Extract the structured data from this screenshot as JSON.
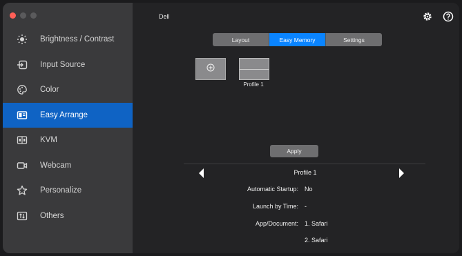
{
  "app": {
    "brand": "Dell"
  },
  "sidebar": {
    "items": [
      {
        "label": "Brightness / Contrast",
        "icon": "brightness-icon",
        "active": false
      },
      {
        "label": "Input Source",
        "icon": "input-source-icon",
        "active": false
      },
      {
        "label": "Color",
        "icon": "color-palette-icon",
        "active": false
      },
      {
        "label": "Easy Arrange",
        "icon": "easy-arrange-icon",
        "active": true
      },
      {
        "label": "KVM",
        "icon": "kvm-icon",
        "active": false
      },
      {
        "label": "Webcam",
        "icon": "webcam-icon",
        "active": false
      },
      {
        "label": "Personalize",
        "icon": "star-icon",
        "active": false
      },
      {
        "label": "Others",
        "icon": "others-icon",
        "active": false
      }
    ]
  },
  "tabs": [
    {
      "label": "Layout",
      "active": false
    },
    {
      "label": "Easy Memory",
      "active": true
    },
    {
      "label": "Settings",
      "active": false
    }
  ],
  "profiles": {
    "add_icon": "plus-circle-icon",
    "items": [
      {
        "label": "Profile 1"
      }
    ]
  },
  "apply_label": "Apply",
  "detail": {
    "profile_name": "Profile 1",
    "rows": [
      {
        "key": "Automatic Startup:",
        "value": "No"
      },
      {
        "key": "Launch by Time:",
        "value": "-"
      },
      {
        "key": "App/Document:",
        "value": "1. Safari"
      },
      {
        "key": "",
        "value": "2. Safari"
      }
    ]
  },
  "colors": {
    "accent": "#0f63c4",
    "tab_active": "#0a84ff",
    "sidebar_bg": "#3a3a3c",
    "main_bg": "#232325"
  }
}
